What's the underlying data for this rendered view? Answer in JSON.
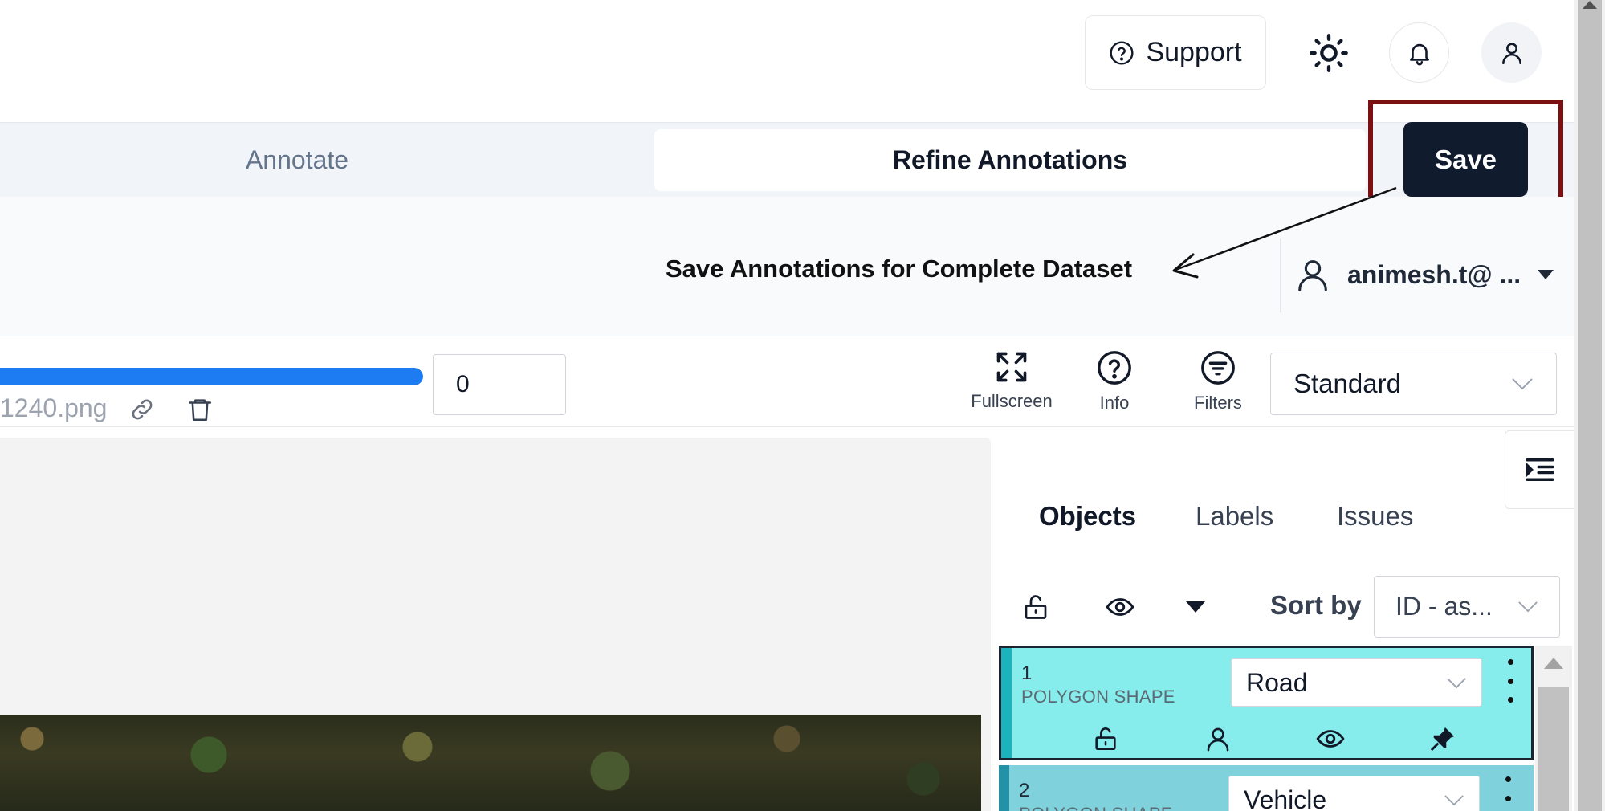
{
  "header": {
    "support_label": "Support",
    "icons": [
      "help-circle-icon",
      "sun-icon",
      "bell-icon",
      "user-icon"
    ]
  },
  "mode_tabs": {
    "annotate": "Annotate",
    "refine": "Refine Annotations",
    "active": "Refine Annotations"
  },
  "save_label": "Save",
  "callout": {
    "text": "Save Annotations for Complete Dataset",
    "highlight_color": "#7b1013"
  },
  "account": {
    "email": "animesh.t@ ..."
  },
  "toolbar": {
    "filename": "1240.png",
    "frame_value": "0",
    "progress_fraction": 1.0,
    "fullscreen_label": "Fullscreen",
    "info_label": "Info",
    "filters_label": "Filters",
    "view_mode": "Standard"
  },
  "panel": {
    "tabs": [
      "Objects",
      "Labels",
      "Issues"
    ],
    "active_tab": "Objects",
    "sort_label": "Sort by",
    "sort_value": "ID - as..."
  },
  "objects": [
    {
      "id": "1",
      "type": "POLYGON SHAPE",
      "label": "Road",
      "color": "#86ecec"
    },
    {
      "id": "2",
      "type": "POLYGON SHAPE",
      "label": "Vehicle",
      "color": "#7fd2dc"
    }
  ],
  "colors": {
    "save_button": "#111b2e",
    "progress": "#1d7cf2",
    "accent_stripe": "#1cb3bd"
  }
}
